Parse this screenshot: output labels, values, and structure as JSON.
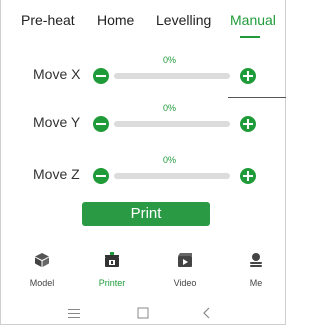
{
  "tabs": [
    {
      "label": "Pre-heat",
      "active": false
    },
    {
      "label": "Home",
      "active": false
    },
    {
      "label": "Levelling",
      "active": false
    },
    {
      "label": "Manual",
      "active": true
    }
  ],
  "axes": [
    {
      "label": "Move X",
      "percent_text": "0%",
      "value": 0
    },
    {
      "label": "Move Y",
      "percent_text": "0%",
      "value": 0
    },
    {
      "label": "Move Z",
      "percent_text": "0%",
      "value": 0
    }
  ],
  "print_button": {
    "label": "Print"
  },
  "bottom_nav": [
    {
      "label": "Model",
      "icon": "cube-icon",
      "active": false
    },
    {
      "label": "Printer",
      "icon": "printer-icon",
      "active": true
    },
    {
      "label": "Video",
      "icon": "video-icon",
      "active": false
    },
    {
      "label": "Me",
      "icon": "person-icon",
      "active": false
    }
  ],
  "colors": {
    "accent": "#1f9b3a",
    "print_button": "#2a9a45",
    "track": "#dcdcdc"
  }
}
